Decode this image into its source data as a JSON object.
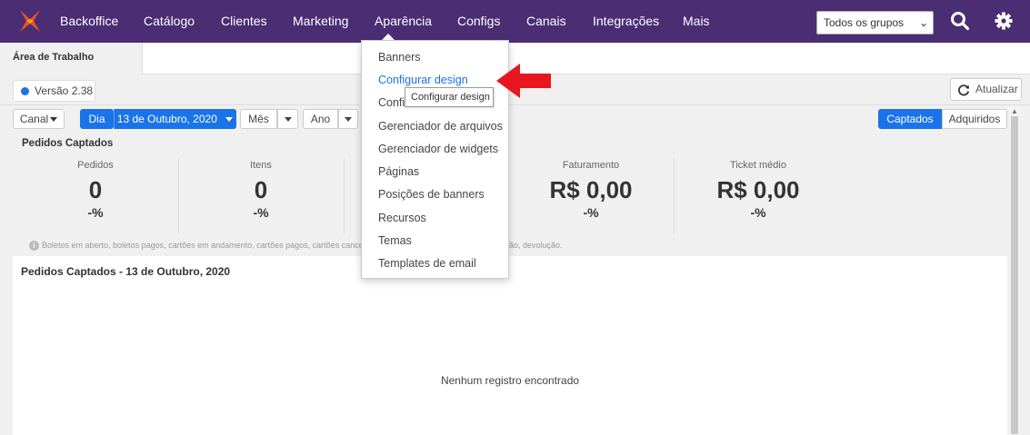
{
  "topbar": {
    "logo_icon": "company-logo",
    "nav": [
      "Backoffice",
      "Catálogo",
      "Clientes",
      "Marketing",
      "Aparência",
      "Configs",
      "Canais",
      "Integrações",
      "Mais"
    ],
    "group_select": "Todos os grupos",
    "search_icon": "search-icon",
    "settings_icon": "gear-icon"
  },
  "tabs": {
    "active": "Área de Trabalho"
  },
  "version": "Versão 2.38",
  "refresh_label": "Atualizar",
  "filters": {
    "canal": "Canal",
    "dia": "Dia",
    "date": "13 de Outubro, 2020",
    "mes": "Mês",
    "ano": "Ano",
    "captados": "Captados",
    "adquiridos": "Adquiridos"
  },
  "summary": {
    "title": "Pedidos Captados",
    "stats": [
      {
        "label": "Pedidos",
        "value": "0",
        "pct": "-%"
      },
      {
        "label": "Itens",
        "value": "0",
        "pct": "-%"
      },
      {
        "label": "Faturamento",
        "value": "R$ 0,00",
        "pct": "-%"
      },
      {
        "label": "Ticket médio",
        "value": "R$ 0,00",
        "pct": "-%"
      }
    ],
    "note_left": "Boletos em aberto, boletos pagos, cartões em andamento, cartões pagos, cartões cancelados, bo",
    "note_right": "ão, devolução."
  },
  "panel": {
    "title": "Pedidos Captados - 13 de Outubro, 2020",
    "empty": "Nenhum registro encontrado"
  },
  "menu": {
    "items": [
      "Banners",
      "Configurar design",
      "Confi",
      "Gerenciador de arquivos",
      "Gerenciador de widgets",
      "Páginas",
      "Posições de banners",
      "Recursos",
      "Temas",
      "Templates de email"
    ],
    "tooltip": "Configurar design"
  },
  "colors": {
    "nav_bg": "#4a2d73",
    "accent": "#1a73e8",
    "arrow": "#e8161e"
  }
}
